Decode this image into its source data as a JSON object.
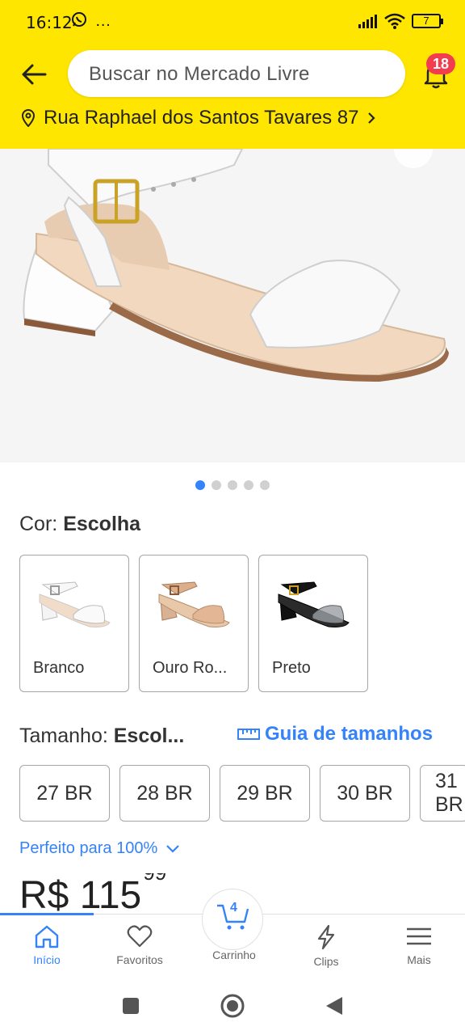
{
  "status": {
    "time": "16:12",
    "extra": "…",
    "battery": "7"
  },
  "header": {
    "search_placeholder": "Buscar no Mercado Livre",
    "notification_count": "18",
    "address": "Rua Raphael dos Santos Tavares 87"
  },
  "gallery": {
    "total_images": 5,
    "current_index": 0
  },
  "color": {
    "label": "Cor:",
    "value": "Escolha",
    "options": [
      "Branco",
      "Ouro Ro...",
      "Preto"
    ]
  },
  "size": {
    "label": "Tamanho:",
    "value": "Escol...",
    "guide_label": "Guia de tamanhos",
    "options": [
      "27 BR",
      "28 BR",
      "29 BR",
      "30 BR",
      "31 BR"
    ],
    "fit_text": "Perfeito para 100%"
  },
  "price": {
    "currency": "R$",
    "whole": "115",
    "cents": "99"
  },
  "bottom_nav": {
    "items": [
      "Início",
      "Favoritos",
      "Carrinho",
      "Clips",
      "Mais"
    ],
    "cart_count": "4",
    "active": "Início"
  },
  "colors": {
    "brand_yellow": "#ffe600",
    "accent_blue": "#3483fa",
    "badge_red": "#f23d4f"
  }
}
